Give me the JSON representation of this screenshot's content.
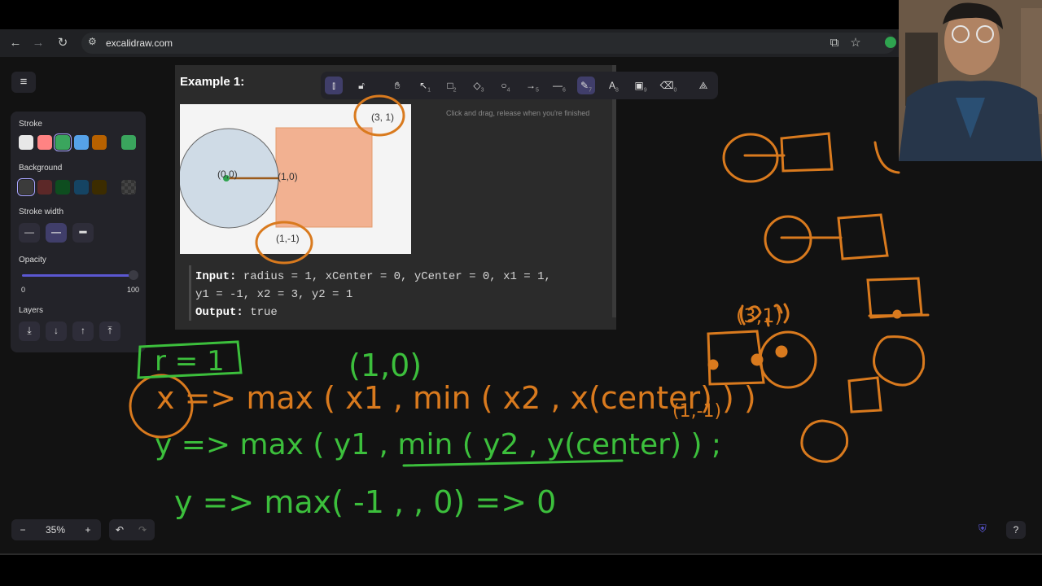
{
  "browser": {
    "url": "excalidraw.com",
    "back_icon": "arrow-left-icon",
    "forward_icon": "arrow-right-icon",
    "reload_icon": "reload-icon"
  },
  "toolbar": {
    "tools": [
      {
        "name": "lock",
        "shortcut": ""
      },
      {
        "name": "hand",
        "shortcut": ""
      },
      {
        "name": "selection",
        "shortcut": "1"
      },
      {
        "name": "rectangle",
        "shortcut": "2"
      },
      {
        "name": "diamond",
        "shortcut": "3"
      },
      {
        "name": "ellipse",
        "shortcut": "4"
      },
      {
        "name": "arrow",
        "shortcut": "5"
      },
      {
        "name": "line",
        "shortcut": "6"
      },
      {
        "name": "draw",
        "shortcut": "7"
      },
      {
        "name": "text",
        "shortcut": "8"
      },
      {
        "name": "image",
        "shortcut": "9"
      },
      {
        "name": "eraser",
        "shortcut": "0"
      }
    ],
    "hint": "Click and drag, release when you're finished"
  },
  "properties": {
    "stroke_label": "Stroke",
    "background_label": "Background",
    "stroke_width_label": "Stroke width",
    "opacity_label": "Opacity",
    "opacity_min": "0",
    "opacity_max": "100",
    "opacity_value": 100,
    "layers_label": "Layers",
    "stroke_colors": [
      "#e8e8e8",
      "#ff8383",
      "#3aa55d",
      "#56a2e8",
      "#b76100"
    ],
    "stroke_selected": "#3aa55d",
    "background_colors": [
      "#3b3b3b",
      "#5c2828",
      "#0e4d1f",
      "#154463",
      "#3c2c00"
    ]
  },
  "example": {
    "title": "Example 1:",
    "input_label": "Input:",
    "input_line1": " radius = 1, xCenter = 0, yCenter = 0, x1 = 1,",
    "input_line2": "y1 = -1, x2 = 3, y2 = 1",
    "output_label": "Output:",
    "output_value": " true",
    "fig_labels": {
      "center": "(0,0)",
      "one": "(1,0)",
      "p31": "(3, 1)",
      "p1m1": "(1,-1)",
      "r": "1"
    }
  },
  "handwriting": {
    "r_eq": "r = 1",
    "pt10": "(1,0)",
    "line_x": "x => max ( x1 , min ( x2 , x(center) ) )",
    "line_y": "y => max ( y1 , min ( y2 , y(center) ) ;",
    "line_y2": "y => max( -1 , , 0) => 0",
    "pt1m1": "(1,-1)",
    "pt31": "(3,1)"
  },
  "zoom": {
    "minus": "−",
    "value": "35%",
    "plus": "+"
  },
  "bottom": {
    "undo": "↶",
    "redo": "↷",
    "help": "?"
  }
}
